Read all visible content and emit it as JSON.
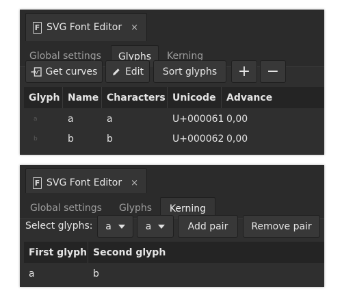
{
  "panel1": {
    "window_title": "SVG Font Editor",
    "close_glyph": "×",
    "tabs": [
      "Global settings",
      "Glyphs",
      "Kerning"
    ],
    "active_tab": "Glyphs",
    "toolbar": {
      "get_curves": "Get curves",
      "edit": "Edit",
      "sort_glyphs": "Sort glyphs",
      "add": "+",
      "remove": "−"
    },
    "columns": [
      "Glyph",
      "Name",
      "Characters",
      "Unicode",
      "Advance"
    ],
    "rows": [
      {
        "glyph": "a",
        "name": "a",
        "characters": "a",
        "unicode": "U+000061",
        "advance": "0,00"
      },
      {
        "glyph": "b",
        "name": "b",
        "characters": "b",
        "unicode": "U+000062",
        "advance": "0,00"
      }
    ]
  },
  "panel2": {
    "window_title": "SVG Font Editor",
    "close_glyph": "×",
    "tabs": [
      "Global settings",
      "Glyphs",
      "Kerning"
    ],
    "active_tab": "Kerning",
    "select_label": "Select glyphs:",
    "first_select": "a",
    "second_select": "a",
    "add_pair": "Add pair",
    "remove_pair": "Remove pair",
    "columns": [
      "First glyph",
      "Second glyph"
    ],
    "rows": [
      {
        "first": "a",
        "second": "b"
      }
    ]
  }
}
